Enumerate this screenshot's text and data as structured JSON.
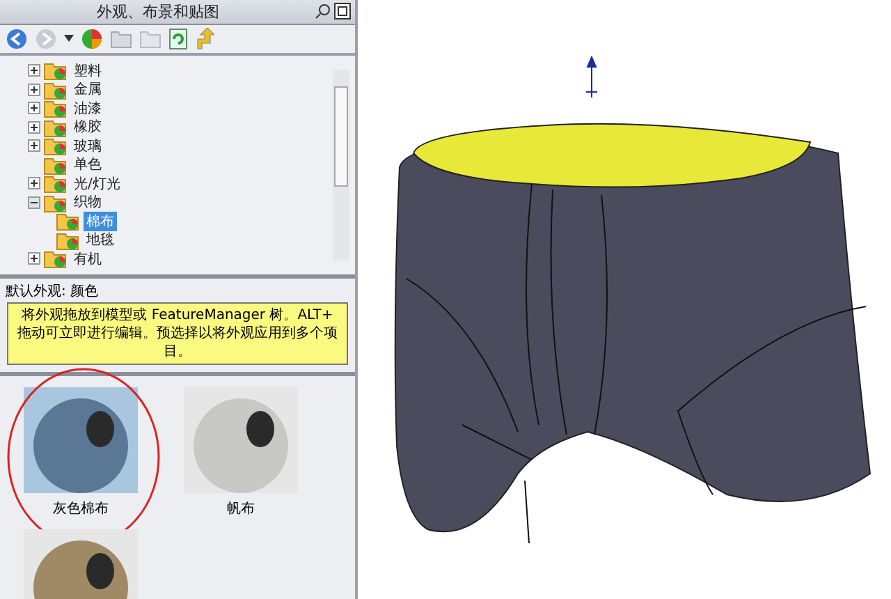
{
  "panel": {
    "title": "外观、布景和贴图"
  },
  "tree": [
    {
      "label": "塑料",
      "expanded": false,
      "selected": false
    },
    {
      "label": "金属",
      "expanded": false,
      "selected": false
    },
    {
      "label": "油漆",
      "expanded": false,
      "selected": false
    },
    {
      "label": "橡胶",
      "expanded": false,
      "selected": false
    },
    {
      "label": "玻璃",
      "expanded": false,
      "selected": false
    },
    {
      "label": "单色",
      "selected": false
    },
    {
      "label": "光/灯光",
      "expanded": false,
      "selected": false
    },
    {
      "label": "织物",
      "expanded": true,
      "selected": false,
      "children": [
        {
          "label": "棉布",
          "selected": true
        },
        {
          "label": "地毯",
          "selected": false
        }
      ]
    },
    {
      "label": "有机",
      "expanded": false,
      "selected": false
    }
  ],
  "default_appearance": "默认外观: 颜色",
  "tip": "将外观拖放到模型或 FeatureManager 树。ALT+ 拖动可立即进行编辑。预选择以将外观应用到多个项目。",
  "thumbnails": [
    {
      "label": "灰色棉布",
      "color": "#5a7896",
      "selected": true
    },
    {
      "label": "帆布",
      "color": "#c8c8c4",
      "selected": false
    },
    {
      "color": "#a08a66",
      "selected": false
    }
  ]
}
